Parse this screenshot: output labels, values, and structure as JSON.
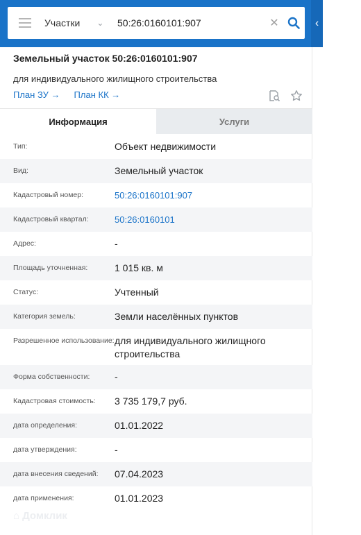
{
  "search": {
    "type_selected": "Участки",
    "query": "50:26:0160101:907"
  },
  "object": {
    "title": "Земельный участок 50:26:0160101:907",
    "subtitle": "для индивидуального жилищного строительства",
    "links": [
      "План ЗУ",
      "План КК"
    ]
  },
  "tabs": [
    {
      "label": "Информация",
      "active": true
    },
    {
      "label": "Услуги",
      "active": false
    }
  ],
  "rows": [
    {
      "label": "Тип:",
      "value": "Объект недвижимости"
    },
    {
      "label": "Вид:",
      "value": "Земельный участок"
    },
    {
      "label": "Кадастровый номер:",
      "value": "50:26:0160101:907",
      "link": true
    },
    {
      "label": "Кадастровый квартал:",
      "value": "50:26:0160101",
      "link": true
    },
    {
      "label": "Адрес:",
      "value": "-"
    },
    {
      "label": "Площадь уточненная:",
      "value": "1 015 кв. м"
    },
    {
      "label": "Статус:",
      "value": "Учтенный"
    },
    {
      "label": "Категория земель:",
      "value": "Земли населённых пунктов"
    },
    {
      "label": "Разрешенное использование:",
      "value": "для индивидуального жилищного строительства"
    },
    {
      "label": "Форма собственности:",
      "value": "-"
    },
    {
      "label": "Кадастровая стоимость:",
      "value": "3 735 179,7 руб."
    },
    {
      "label": "дата определения:",
      "value": "01.01.2022"
    },
    {
      "label": "дата утверждения:",
      "value": "-"
    },
    {
      "label": "дата внесения сведений:",
      "value": "07.04.2023"
    },
    {
      "label": "дата применения:",
      "value": "01.01.2023"
    }
  ],
  "watermark": "Домклик",
  "colors": {
    "accent": "#1a73c8",
    "row_alt": "#f4f5f7",
    "tab_inactive": "#e9ecef"
  },
  "icons": [
    "menu-icon",
    "chevron-down-icon",
    "close-icon",
    "search-icon",
    "collapse-left-icon",
    "arrow-right-icon",
    "document-search-icon",
    "star-icon"
  ]
}
